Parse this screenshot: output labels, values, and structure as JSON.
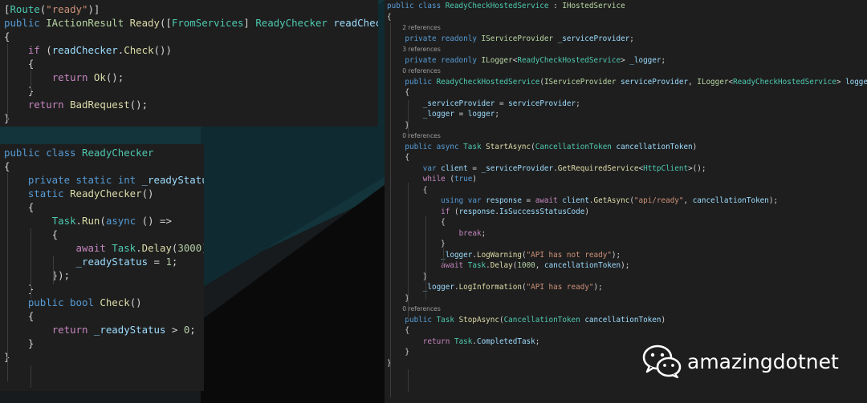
{
  "panel1": {
    "lines": [
      [
        [
          "txt",
          "["
        ],
        [
          "cls",
          "Route"
        ],
        [
          "txt",
          "("
        ],
        [
          "str",
          "\"ready\""
        ],
        [
          "txt",
          ")]"
        ]
      ],
      [
        [
          "kw",
          "public "
        ],
        [
          "iface",
          "IActionResult "
        ],
        [
          "mth",
          "Ready"
        ],
        [
          "txt",
          "(["
        ],
        [
          "cls",
          "FromServices"
        ],
        [
          "txt",
          "] "
        ],
        [
          "cls",
          "ReadyChecker "
        ],
        [
          "var",
          "readChecker"
        ],
        [
          "txt",
          ")"
        ]
      ],
      [
        [
          "txt",
          "{"
        ]
      ],
      [
        [
          "txt",
          "    "
        ],
        [
          "ctrl",
          "if "
        ],
        [
          "txt",
          "("
        ],
        [
          "var",
          "readChecker"
        ],
        [
          "txt",
          "."
        ],
        [
          "mth",
          "Check"
        ],
        [
          "txt",
          "())"
        ]
      ],
      [
        [
          "txt",
          "    {"
        ]
      ],
      [
        [
          "txt",
          "        "
        ],
        [
          "ctrl",
          "return "
        ],
        [
          "mth",
          "Ok"
        ],
        [
          "txt",
          "();"
        ]
      ],
      [
        [
          "txt",
          "    }"
        ]
      ],
      [
        [
          "txt",
          "    "
        ],
        [
          "ctrl",
          "return "
        ],
        [
          "mth",
          "BadRequest"
        ],
        [
          "txt",
          "();"
        ]
      ],
      [
        [
          "txt",
          "}"
        ]
      ]
    ]
  },
  "panel2": {
    "lines": [
      [
        [
          "kw",
          "public class "
        ],
        [
          "cls",
          "ReadyChecker"
        ]
      ],
      [
        [
          "txt",
          "{"
        ]
      ],
      [
        [
          "txt",
          "    "
        ],
        [
          "kw",
          "private static int "
        ],
        [
          "var",
          "_readyStatus"
        ],
        [
          "txt",
          ";"
        ]
      ],
      [
        [
          "txt",
          ""
        ]
      ],
      [
        [
          "txt",
          "    "
        ],
        [
          "kw",
          "static "
        ],
        [
          "mth",
          "ReadyChecker"
        ],
        [
          "txt",
          "()"
        ]
      ],
      [
        [
          "txt",
          "    {"
        ]
      ],
      [
        [
          "txt",
          "        "
        ],
        [
          "cls",
          "Task"
        ],
        [
          "txt",
          "."
        ],
        [
          "mth",
          "Run"
        ],
        [
          "txt",
          "("
        ],
        [
          "kw",
          "async "
        ],
        [
          "txt",
          "() =>"
        ]
      ],
      [
        [
          "txt",
          "        {"
        ]
      ],
      [
        [
          "txt",
          "            "
        ],
        [
          "ctrl",
          "await "
        ],
        [
          "cls",
          "Task"
        ],
        [
          "txt",
          "."
        ],
        [
          "mth",
          "Delay"
        ],
        [
          "txt",
          "("
        ],
        [
          "num",
          "3000"
        ],
        [
          "txt",
          ");"
        ]
      ],
      [
        [
          "txt",
          "            "
        ],
        [
          "var",
          "_readyStatus"
        ],
        [
          "txt",
          " = "
        ],
        [
          "num",
          "1"
        ],
        [
          "txt",
          ";"
        ]
      ],
      [
        [
          "txt",
          "        });"
        ]
      ],
      [
        [
          "txt",
          "    }"
        ]
      ],
      [
        [
          "txt",
          ""
        ]
      ],
      [
        [
          "txt",
          "    "
        ],
        [
          "kw",
          "public bool "
        ],
        [
          "mth",
          "Check"
        ],
        [
          "txt",
          "()"
        ]
      ],
      [
        [
          "txt",
          "    {"
        ]
      ],
      [
        [
          "txt",
          "        "
        ],
        [
          "ctrl",
          "return "
        ],
        [
          "var",
          "_readyStatus"
        ],
        [
          "txt",
          " > "
        ],
        [
          "num",
          "0"
        ],
        [
          "txt",
          ";"
        ]
      ],
      [
        [
          "txt",
          "    }"
        ]
      ],
      [
        [
          "txt",
          "}"
        ]
      ]
    ]
  },
  "panel3": {
    "lines": [
      {
        "code": [
          [
            "kw",
            "public class "
          ],
          [
            "cls",
            "ReadyCheckHostedService"
          ],
          [
            "txt",
            " : "
          ],
          [
            "iface",
            "IHostedService"
          ]
        ]
      },
      {
        "code": [
          [
            "txt",
            "{"
          ]
        ]
      },
      {
        "ref": "        2 references"
      },
      {
        "code": [
          [
            "txt",
            "    "
          ],
          [
            "kw",
            "private readonly "
          ],
          [
            "iface",
            "IServiceProvider "
          ],
          [
            "var",
            "_serviceProvider"
          ],
          [
            "txt",
            ";"
          ]
        ]
      },
      {
        "ref": "        3 references"
      },
      {
        "code": [
          [
            "txt",
            "    "
          ],
          [
            "kw",
            "private readonly "
          ],
          [
            "iface",
            "ILogger"
          ],
          [
            "txt",
            "<"
          ],
          [
            "cls",
            "ReadyCheckHostedService"
          ],
          [
            "txt",
            "> "
          ],
          [
            "var",
            "_logger"
          ],
          [
            "txt",
            ";"
          ]
        ]
      },
      {
        "code": [
          [
            "txt",
            ""
          ]
        ]
      },
      {
        "ref": "        0 references"
      },
      {
        "code": [
          [
            "txt",
            "    "
          ],
          [
            "kw",
            "public "
          ],
          [
            "cls",
            "ReadyCheckHostedService"
          ],
          [
            "txt",
            "("
          ],
          [
            "iface",
            "IServiceProvider "
          ],
          [
            "var",
            "serviceProvider"
          ],
          [
            "txt",
            ", "
          ],
          [
            "iface",
            "ILogger"
          ],
          [
            "txt",
            "<"
          ],
          [
            "cls",
            "ReadyCheckHostedService"
          ],
          [
            "txt",
            "> "
          ],
          [
            "var",
            "logger"
          ],
          [
            "txt",
            ")"
          ]
        ]
      },
      {
        "code": [
          [
            "txt",
            "    {"
          ]
        ]
      },
      {
        "code": [
          [
            "txt",
            "        "
          ],
          [
            "var",
            "_serviceProvider"
          ],
          [
            "txt",
            " = "
          ],
          [
            "var",
            "serviceProvider"
          ],
          [
            "txt",
            ";"
          ]
        ]
      },
      {
        "code": [
          [
            "txt",
            "        "
          ],
          [
            "var",
            "_logger"
          ],
          [
            "txt",
            " = "
          ],
          [
            "var",
            "logger"
          ],
          [
            "txt",
            ";"
          ]
        ]
      },
      {
        "code": [
          [
            "txt",
            "    }"
          ]
        ]
      },
      {
        "code": [
          [
            "txt",
            ""
          ]
        ]
      },
      {
        "ref": "        0 references"
      },
      {
        "code": [
          [
            "txt",
            "    "
          ],
          [
            "kw",
            "public async "
          ],
          [
            "cls",
            "Task "
          ],
          [
            "mth",
            "StartAsync"
          ],
          [
            "txt",
            "("
          ],
          [
            "cls",
            "CancellationToken "
          ],
          [
            "var",
            "cancellationToken"
          ],
          [
            "txt",
            ")"
          ]
        ]
      },
      {
        "code": [
          [
            "txt",
            "    {"
          ]
        ]
      },
      {
        "code": [
          [
            "txt",
            "        "
          ],
          [
            "kw",
            "var "
          ],
          [
            "var",
            "client"
          ],
          [
            "txt",
            " = "
          ],
          [
            "var",
            "_serviceProvider"
          ],
          [
            "txt",
            "."
          ],
          [
            "mth",
            "GetRequiredService"
          ],
          [
            "txt",
            "<"
          ],
          [
            "cls",
            "HttpClient"
          ],
          [
            "txt",
            ">();"
          ]
        ]
      },
      {
        "code": [
          [
            "txt",
            "        "
          ],
          [
            "ctrl",
            "while "
          ],
          [
            "txt",
            "("
          ],
          [
            "kw",
            "true"
          ],
          [
            "txt",
            ")"
          ]
        ]
      },
      {
        "code": [
          [
            "txt",
            "        {"
          ]
        ]
      },
      {
        "code": [
          [
            "txt",
            "            "
          ],
          [
            "kw",
            "using var "
          ],
          [
            "var",
            "response"
          ],
          [
            "txt",
            " = "
          ],
          [
            "ctrl",
            "await "
          ],
          [
            "var",
            "client"
          ],
          [
            "txt",
            "."
          ],
          [
            "mth",
            "GetAsync"
          ],
          [
            "txt",
            "("
          ],
          [
            "str",
            "\"api/ready\""
          ],
          [
            "txt",
            ", "
          ],
          [
            "var",
            "cancellationToken"
          ],
          [
            "txt",
            ");"
          ]
        ]
      },
      {
        "code": [
          [
            "txt",
            "            "
          ],
          [
            "ctrl",
            "if "
          ],
          [
            "txt",
            "("
          ],
          [
            "var",
            "response"
          ],
          [
            "txt",
            "."
          ],
          [
            "var",
            "IsSuccessStatusCode"
          ],
          [
            "txt",
            ")"
          ]
        ]
      },
      {
        "code": [
          [
            "txt",
            "            {"
          ]
        ]
      },
      {
        "code": [
          [
            "txt",
            "                "
          ],
          [
            "ctrl",
            "break"
          ],
          [
            "txt",
            ";"
          ]
        ]
      },
      {
        "code": [
          [
            "txt",
            "            }"
          ]
        ]
      },
      {
        "code": [
          [
            "txt",
            "            "
          ],
          [
            "var",
            "_logger"
          ],
          [
            "txt",
            "."
          ],
          [
            "mth",
            "LogWarning"
          ],
          [
            "txt",
            "("
          ],
          [
            "str",
            "\"API has not ready\""
          ],
          [
            "txt",
            ");"
          ]
        ]
      },
      {
        "code": [
          [
            "txt",
            "            "
          ],
          [
            "ctrl",
            "await "
          ],
          [
            "cls",
            "Task"
          ],
          [
            "txt",
            "."
          ],
          [
            "mth",
            "Delay"
          ],
          [
            "txt",
            "("
          ],
          [
            "num",
            "1000"
          ],
          [
            "txt",
            ", "
          ],
          [
            "var",
            "cancellationToken"
          ],
          [
            "txt",
            ");"
          ]
        ]
      },
      {
        "code": [
          [
            "txt",
            "        }"
          ]
        ]
      },
      {
        "code": [
          [
            "txt",
            "        "
          ],
          [
            "var",
            "_logger"
          ],
          [
            "txt",
            "."
          ],
          [
            "mth",
            "LogInformation"
          ],
          [
            "txt",
            "("
          ],
          [
            "str",
            "\"API has ready\""
          ],
          [
            "txt",
            ");"
          ]
        ]
      },
      {
        "code": [
          [
            "txt",
            "    }"
          ]
        ]
      },
      {
        "code": [
          [
            "txt",
            ""
          ]
        ]
      },
      {
        "ref": "        0 references"
      },
      {
        "code": [
          [
            "txt",
            "    "
          ],
          [
            "kw",
            "public "
          ],
          [
            "cls",
            "Task "
          ],
          [
            "mth",
            "StopAsync"
          ],
          [
            "txt",
            "("
          ],
          [
            "cls",
            "CancellationToken "
          ],
          [
            "var",
            "cancellationToken"
          ],
          [
            "txt",
            ")"
          ]
        ]
      },
      {
        "code": [
          [
            "txt",
            "    {"
          ]
        ]
      },
      {
        "code": [
          [
            "txt",
            "        "
          ],
          [
            "ctrl",
            "return "
          ],
          [
            "cls",
            "Task"
          ],
          [
            "txt",
            "."
          ],
          [
            "var",
            "CompletedTask"
          ],
          [
            "txt",
            ";"
          ]
        ]
      },
      {
        "code": [
          [
            "txt",
            "    }"
          ]
        ]
      },
      {
        "code": [
          [
            "txt",
            "}"
          ]
        ]
      }
    ]
  },
  "watermark": {
    "text": "amazingdotnet",
    "icon": "wechat-icon"
  }
}
